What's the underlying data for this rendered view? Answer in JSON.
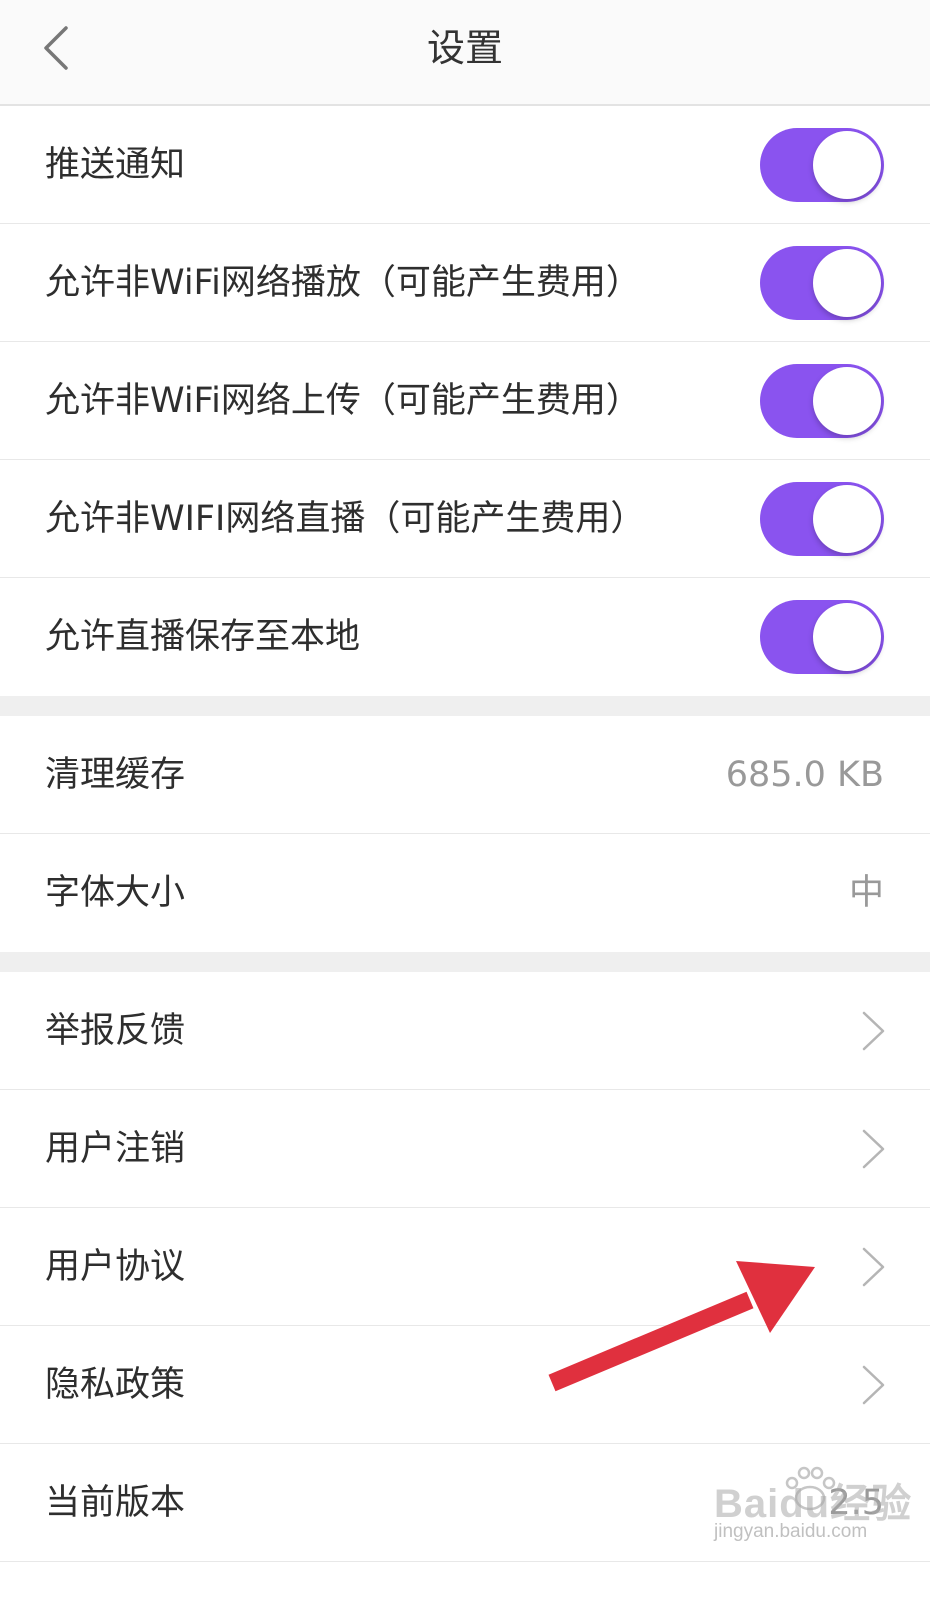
{
  "header": {
    "title": "设置",
    "back_icon": "chevron-left-icon"
  },
  "toggles": [
    {
      "label": "推送通知",
      "on": true
    },
    {
      "label": "允许非WiFi网络播放（可能产生费用）",
      "on": true
    },
    {
      "label": "允许非WiFi网络上传（可能产生费用）",
      "on": true
    },
    {
      "label": "允许非WIFI网络直播（可能产生费用）",
      "on": true
    },
    {
      "label": "允许直播保存至本地",
      "on": true
    }
  ],
  "storage": [
    {
      "label": "清理缓存",
      "value": "685.0 KB"
    },
    {
      "label": "字体大小",
      "value": "中"
    }
  ],
  "links": [
    {
      "label": "举报反馈",
      "icon": "chevron-right-icon"
    },
    {
      "label": "用户注销",
      "icon": "chevron-right-icon"
    },
    {
      "label": "用户协议",
      "icon": "chevron-right-icon"
    },
    {
      "label": "隐私政策",
      "icon": "chevron-right-icon"
    }
  ],
  "version": {
    "label": "当前版本",
    "value": "2.5"
  },
  "watermark": {
    "logo": "Baidu经验",
    "url": "jingyan.baidu.com"
  },
  "colors": {
    "toggle_on": "#8a53ef",
    "annotation_arrow": "#e0303e",
    "section_gap": "#efefef"
  }
}
